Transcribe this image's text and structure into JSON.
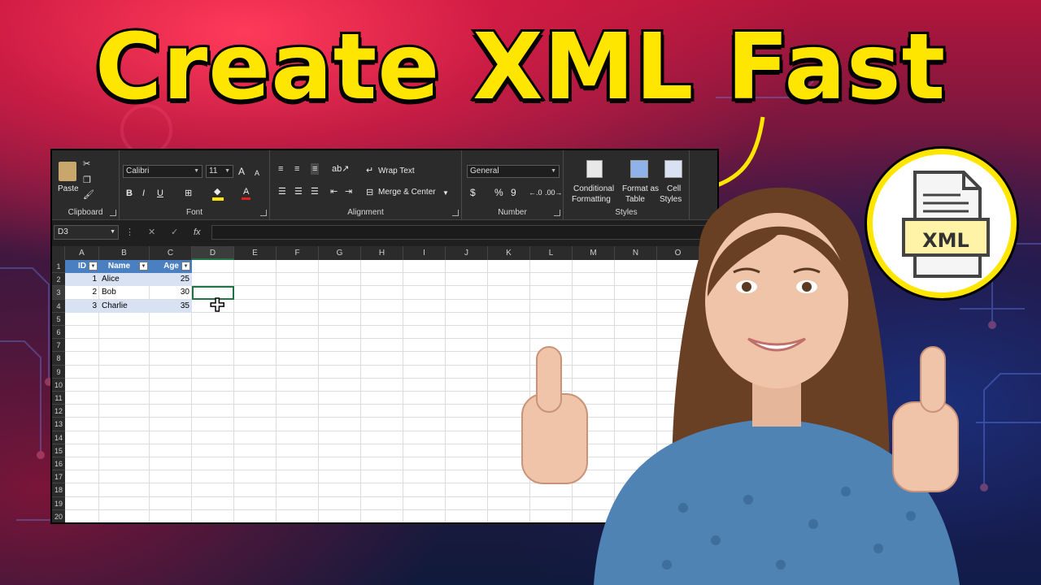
{
  "headline": "Create XML Fast",
  "badge_label": "XML",
  "ribbon": {
    "clipboard": {
      "paste": "Paste",
      "group": "Clipboard"
    },
    "font": {
      "name": "Calibri",
      "size": "11",
      "bold": "B",
      "italic": "I",
      "underline": "U",
      "grow": "A",
      "shrink": "A",
      "color": "A",
      "group": "Font"
    },
    "alignment": {
      "wrap": "Wrap Text",
      "merge": "Merge & Center",
      "group": "Alignment"
    },
    "number": {
      "format": "General",
      "currency": "$",
      "percent": "%",
      "comma": "9",
      "group": "Number"
    },
    "styles": {
      "conditional_1": "Conditional",
      "conditional_2": "Formatting",
      "format_table_1": "Format as",
      "format_table_2": "Table",
      "cell_styles_1": "Cell",
      "cell_styles_2": "Styles",
      "group": "Styles"
    }
  },
  "formula_bar": {
    "name_box": "D3",
    "fx": "fx",
    "cancel": "✕",
    "enter": "✓",
    "menu": "⋮"
  },
  "sheet": {
    "columns": [
      "A",
      "B",
      "C",
      "D",
      "E",
      "F",
      "G",
      "H",
      "I",
      "J",
      "K",
      "L",
      "M",
      "N",
      "O"
    ],
    "rows": [
      "1",
      "2",
      "3",
      "4",
      "5",
      "6",
      "7",
      "8",
      "9",
      "10",
      "11",
      "12",
      "13",
      "14",
      "15",
      "16",
      "17",
      "18",
      "19",
      "20"
    ],
    "table_headers": [
      "ID",
      "Name",
      "Age"
    ],
    "table_rows": [
      [
        "1",
        "Alice",
        "25"
      ],
      [
        "2",
        "Bob",
        "30"
      ],
      [
        "3",
        "Charlie",
        "35"
      ]
    ]
  },
  "colors": {
    "headline": "#ffe600",
    "table_header": "#4a7fc1",
    "table_band": "#d9e2f3",
    "selection": "#217346",
    "badge_ring": "#ffe600"
  }
}
